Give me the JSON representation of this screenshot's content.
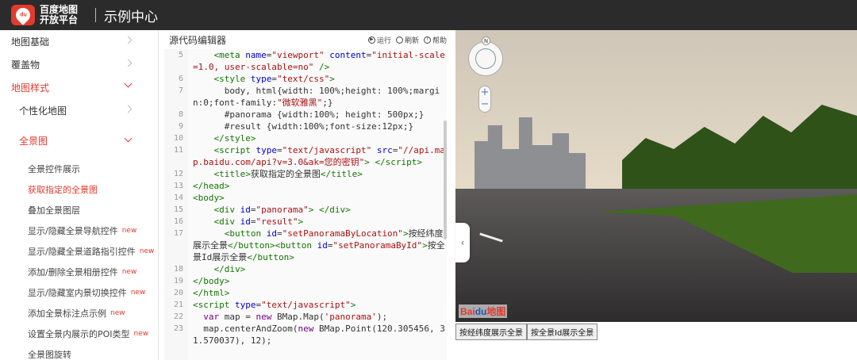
{
  "header": {
    "logo_mark": "du",
    "logo_line1": "百度地图",
    "logo_line2": "开放平台",
    "title": "示例中心"
  },
  "sidebar": {
    "items": [
      {
        "label": "地图基础",
        "level": 1
      },
      {
        "label": "覆盖物",
        "level": 1
      },
      {
        "label": "地图样式",
        "level": 1,
        "active": true
      },
      {
        "label": "个性化地图",
        "level": 2
      },
      {
        "label": "全景图",
        "level": 2,
        "active": true
      }
    ],
    "sub_items": [
      {
        "label": "全景控件展示"
      },
      {
        "label": "获取指定的全景图",
        "active": true
      },
      {
        "label": "叠加全景图层"
      },
      {
        "label": "显示/隐藏全景导航控件",
        "badge": "new"
      },
      {
        "label": "显示/隐藏全景道路指引控件",
        "badge": "new"
      },
      {
        "label": "添加/删除全景相册控件",
        "badge": "new"
      },
      {
        "label": "显示/隐藏室内景切换控件",
        "badge": "new"
      },
      {
        "label": "添加全景标注点示例",
        "badge": "new"
      },
      {
        "label": "设置全景内展示的POI类型",
        "badge": "new"
      },
      {
        "label": "全景图旋转"
      }
    ]
  },
  "editor": {
    "title": "源代码编辑器",
    "run_label": "运行",
    "refresh_label": "刷新",
    "help_label": "帮助",
    "lines": [
      {
        "n": "5",
        "html": "    <span class='tag'>&lt;meta</span> <span class='attr'>name</span>=<span class='str'>\"viewport\"</span> <span class='attr'>content</span>=<span class='str'>\"initial-scale=1.0, user-scalable=no\"</span> <span class='tag'>/&gt;</span>"
      },
      {
        "n": "6",
        "html": "    <span class='tag'>&lt;style</span> <span class='attr'>type</span>=<span class='str'>\"text/css\"</span><span class='tag'>&gt;</span>"
      },
      {
        "n": "7",
        "html": "      body, html{width: 100%;height: 100%;margin:0;font-family:<span class='str'>\"微软雅黑\"</span>;}"
      },
      {
        "n": "8",
        "html": "      #panorama {width:100%; height: 500px;}"
      },
      {
        "n": "9",
        "html": "      #result {width:100%;font-size:12px;}"
      },
      {
        "n": "10",
        "html": "    <span class='tag'>&lt;/style&gt;</span>"
      },
      {
        "n": "11",
        "html": "    <span class='tag'>&lt;script</span> <span class='attr'>type</span>=<span class='str'>\"text/javascript\"</span> <span class='attr'>src</span>=<span class='str'>\"//api.map.baidu.com/api?v=3.0&amp;ak=您的密钥\"</span><span class='tag'>&gt;</span> <span class='tag'>&lt;/script&gt;</span>"
      },
      {
        "n": "12",
        "html": "    <span class='tag'>&lt;title&gt;</span>获取指定的全景图<span class='tag'>&lt;/title&gt;</span>"
      },
      {
        "n": "13",
        "html": "<span class='tag'>&lt;/head&gt;</span>"
      },
      {
        "n": "14",
        "html": "<span class='tag'>&lt;body&gt;</span>"
      },
      {
        "n": "15",
        "html": "    <span class='tag'>&lt;div</span> <span class='attr'>id</span>=<span class='str'>\"panorama\"</span><span class='tag'>&gt;</span> <span class='tag'>&lt;/div&gt;</span>"
      },
      {
        "n": "16",
        "html": "    <span class='tag'>&lt;div</span> <span class='attr'>id</span>=<span class='str'>\"result\"</span><span class='tag'>&gt;</span>"
      },
      {
        "n": "17",
        "html": "      <span class='tag'>&lt;button</span> <span class='attr'>id</span>=<span class='str'>\"setPanoramaByLocation\"</span><span class='tag'>&gt;</span>按经纬度展示全景<span class='tag'>&lt;/button&gt;&lt;button</span> <span class='attr'>id</span>=<span class='str'>\"setPanoramaById\"</span><span class='tag'>&gt;</span>按全景Id展示全景<span class='tag'>&lt;/button&gt;</span>"
      },
      {
        "n": "18",
        "html": "    <span class='tag'>&lt;/div&gt;</span>"
      },
      {
        "n": "19",
        "html": "<span class='tag'>&lt;/body&gt;</span>"
      },
      {
        "n": "20",
        "html": "<span class='tag'>&lt;/html&gt;</span>"
      },
      {
        "n": "21",
        "html": "<span class='tag'>&lt;script</span> <span class='attr'>type</span>=<span class='str'>\"text/javascript\"</span><span class='tag'>&gt;</span>"
      },
      {
        "n": "22",
        "html": "  <span class='kw'>var</span> map = <span class='kw'>new</span> BMap.Map(<span class='str'>'panorama'</span>);"
      },
      {
        "n": "23",
        "html": "  map.centerAndZoom(<span class='kw'>new</span> BMap.Point(120.305456, 31.570037), 12);"
      }
    ]
  },
  "panorama": {
    "compass_north": "N",
    "zoom_in": "+",
    "zoom_out": "−",
    "logo_part1": "Bai",
    "logo_part2": "du",
    "logo_part3": "地图",
    "collapse_glyph": "‹"
  },
  "result": {
    "btn_location": "按经纬度展示全景",
    "btn_id": "按全景Id展示全景"
  },
  "colors": {
    "brand_red": "#e33a2e",
    "topbar": "#2b2b2b"
  }
}
